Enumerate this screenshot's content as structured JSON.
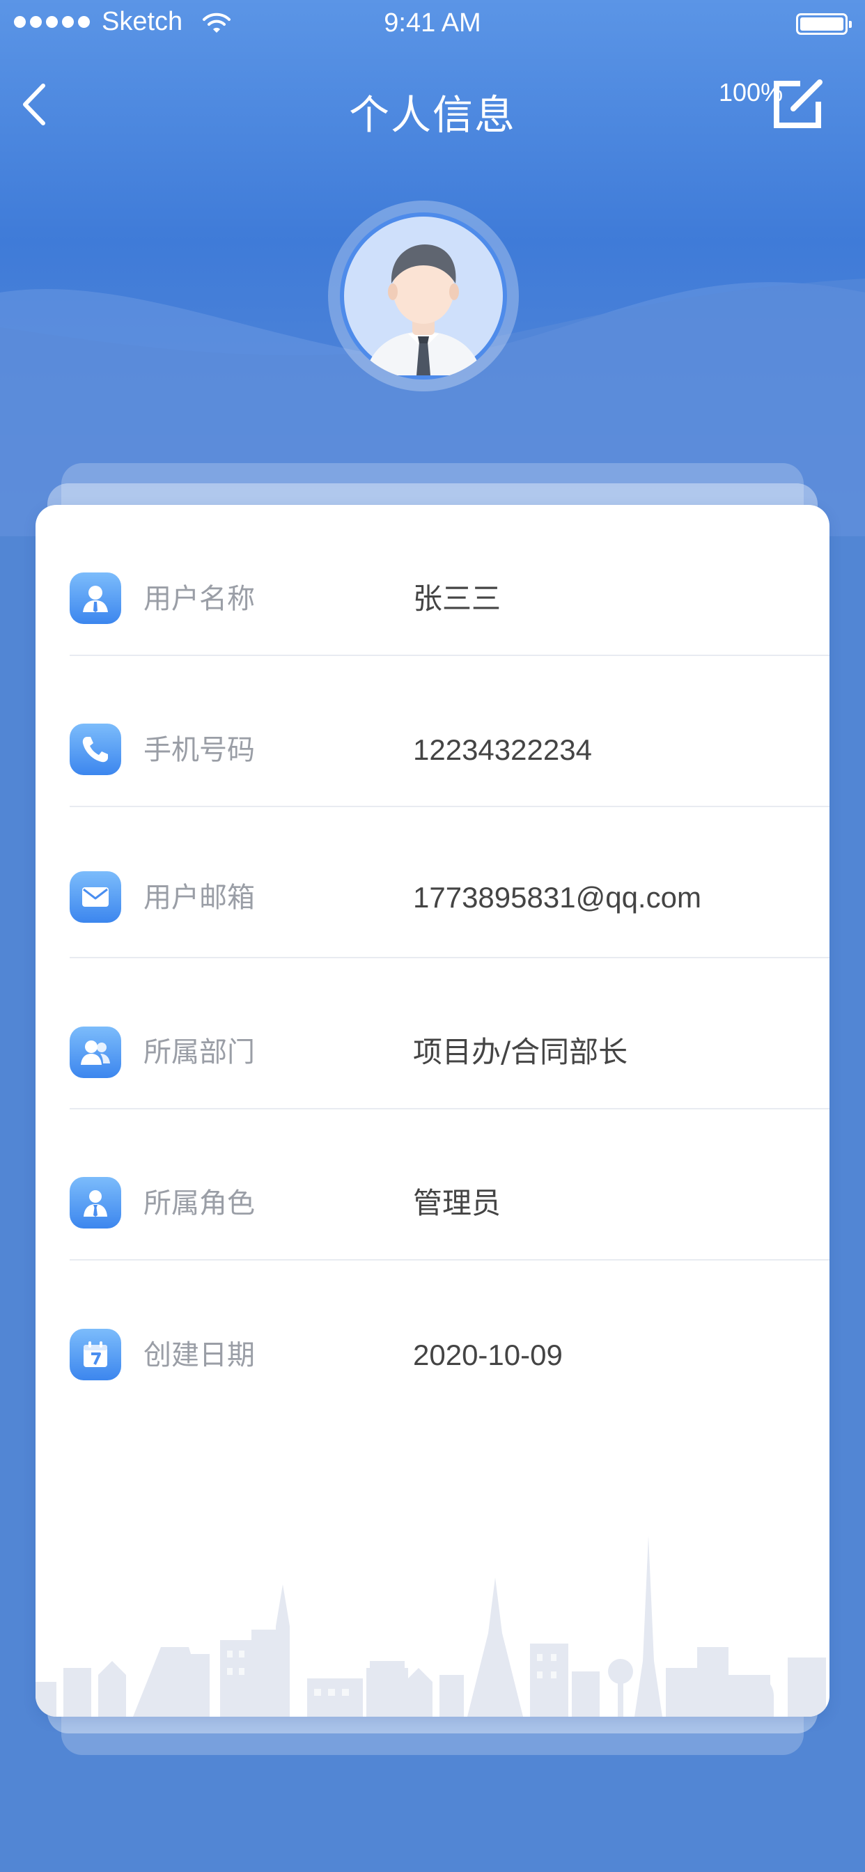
{
  "status_bar": {
    "carrier": "Sketch",
    "time": "9:41 AM",
    "battery_percent": "100%"
  },
  "nav": {
    "title": "个人信息"
  },
  "icons": {
    "back": "chevron-left-icon",
    "edit": "edit-icon",
    "avatar": "user-avatar",
    "username": "user-icon",
    "phone": "phone-icon",
    "email": "mail-icon",
    "department": "group-icon",
    "role": "role-icon",
    "created": "calendar-icon"
  },
  "colors": {
    "header_blue": "#4a86e0",
    "icon_gradient_top": "#7cbcfb",
    "icon_gradient_bottom": "#3c86ee",
    "label_gray": "#9a9ea6",
    "value_dark": "#444444"
  },
  "profile": {
    "rows": [
      {
        "label": "用户名称",
        "value": "张三三"
      },
      {
        "label": "手机号码",
        "value": "12234322234"
      },
      {
        "label": "用户邮箱",
        "value": "1773895831@qq.com"
      },
      {
        "label": "所属部门",
        "value": "项目办/合同部长"
      },
      {
        "label": "所属角色",
        "value": "管理员"
      },
      {
        "label": "创建日期",
        "value": "2020-10-09"
      }
    ]
  }
}
